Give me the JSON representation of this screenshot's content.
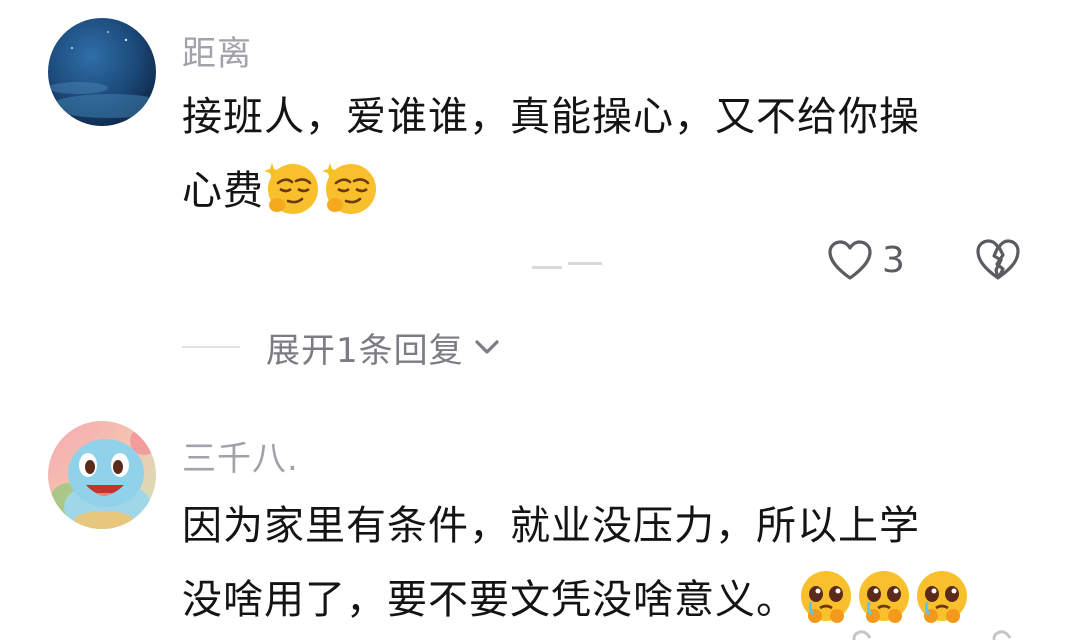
{
  "comments": [
    {
      "username": "距离",
      "content_lines": [
        "接班人，爱谁谁，真能操心，又不给你操",
        "心费"
      ],
      "emoji": "smirk-emoji",
      "emoji_count": 2,
      "like_count": "3",
      "expand_replies_label": "展开1条回复"
    },
    {
      "username": "三千八.",
      "content_lines": [
        "因为家里有条件，就业没压力，所以上学",
        "没啥用了，要不要文凭没啥意义。"
      ],
      "emoji": "pleading-tears-emoji",
      "emoji_count": 3
    }
  ],
  "icons": {
    "like": "heart-outline-icon",
    "dislike": "broken-heart-icon",
    "expand": "chevron-down-icon"
  },
  "colors": {
    "username": "#a2a2a8",
    "content": "#141414",
    "secondary": "#7c7c82",
    "icon": "#5b5b60"
  }
}
